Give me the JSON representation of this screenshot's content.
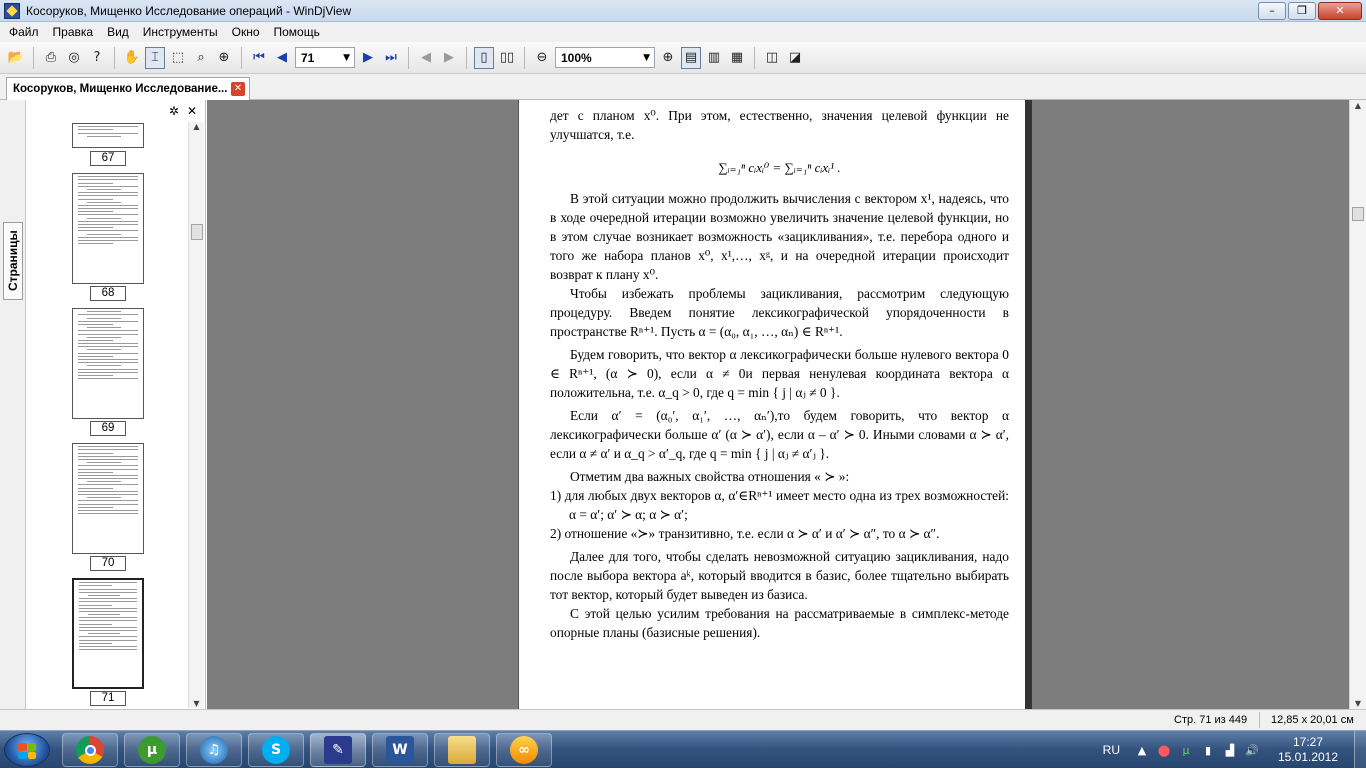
{
  "window": {
    "title": "Косоруков, Мищенко Исследование операций - WinDjView"
  },
  "menu": [
    "Файл",
    "Правка",
    "Вид",
    "Инструменты",
    "Окно",
    "Помощь"
  ],
  "toolbar": {
    "page_value": "71",
    "zoom_value": "100%"
  },
  "tab": {
    "label": "Косоруков, Мищенко Исследование..."
  },
  "sidebar": {
    "tab_label": "Страницы",
    "thumbnails": [
      {
        "page": "67"
      },
      {
        "page": "68"
      },
      {
        "page": "69"
      },
      {
        "page": "70"
      },
      {
        "page": "71"
      }
    ]
  },
  "document": {
    "p1": "дет с планом x⁰. При этом, естественно, значения целевой функции не улучшатся, т.е.",
    "formula1": "∑ᵢ₌₁ⁿ cᵢxᵢ⁰ = ∑ᵢ₌₁ⁿ cᵢxᵢ¹ .",
    "p2": "В этой ситуации можно продолжить вычисления с вектором x¹, надеясь, что в ходе очередной итерации возможно увеличить значение целевой функции, но в этом случае возникает возможность «зацикливания», т.е. перебора одного и того же набора планов x⁰, x¹,…, xᵍ, и на очередной итерации происходит возврат к плану x⁰.",
    "p3": "Чтобы избежать проблемы зацикливания, рассмотрим следующую процедуру. Введем понятие лексикографической упорядоченности в пространстве Rⁿ⁺¹. Пусть α = (α₀, α₁, …, αₙ) ∈ Rⁿ⁺¹.",
    "p4": "Будем говорить, что вектор α лексикографически больше нулевого вектора 0 ∈ Rⁿ⁺¹, (α ≻ 0), если α ≠ 0и первая ненулевая координата вектора α положительна, т.е. α_q > 0, где q = min { j | αⱼ ≠ 0 }.",
    "p5": "Если α′ = (α₀′, α₁′, …, αₙ′),то будем говорить, что вектор α лексикографически больше α′ (α ≻ α′), если α – α′ ≻ 0. Иными словами α ≻ α′, если α ≠ α′ и α_q > α′_q, где q = min { j | αⱼ ≠ α′ⱼ }.",
    "p6": "Отметим два важных свойства отношения « ≻ »:",
    "li1": "1)  для любых двух векторов α, α′∈Rⁿ⁺¹ имеет место одна из трех возможностей: α = α′; α′ ≻ α; α ≻ α′;",
    "li2": "2)  отношение «≻» транзитивно, т.е. если α ≻ α′ и α′ ≻ α″, то α ≻ α″.",
    "p7": "Далее для того, чтобы сделать невозможной ситуацию зацикливания, надо после выбора вектора aᵏ, который вводится в базис, более тщательно выбирать тот вектор, который будет выведен из базиса.",
    "p8": "С этой целью усилим требования на рассматриваемые в симплекс-методе опорные планы (базисные решения)."
  },
  "status": {
    "page_info": "Стр. 71 из 449",
    "page_size": "12,85 x 20,01 см"
  },
  "taskbar": {
    "lang": "RU",
    "time": "17:27",
    "date": "15.01.2012",
    "apps": [
      "chrome",
      "utorrent",
      "itunes",
      "skype",
      "windjview",
      "word",
      "explorer",
      "other"
    ]
  },
  "colors": {
    "viewer_bg": "#7d7d7d",
    "taskbar": "#33527e",
    "accent_blue": "#1b3ea8"
  }
}
